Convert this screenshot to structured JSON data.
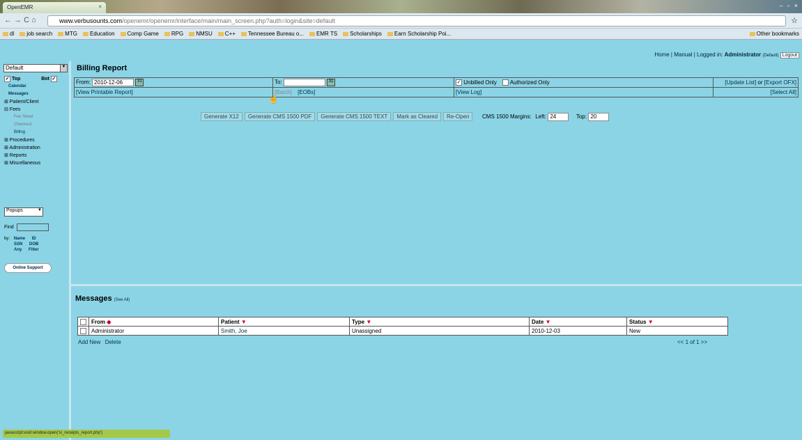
{
  "browser": {
    "tab_title": "OpenEMR",
    "url_domain": "www.verbusounts.com",
    "url_path": "/openemr/openemr/interface/main/main_screen.php?auth=login&site=default",
    "window_controls": "– ▫ ×",
    "bookmarks": [
      "dl",
      "job search",
      "MTG",
      "Education",
      "Comp Game",
      "RPG",
      "NMSU",
      "C++",
      "Tennessee Bureau o...",
      "EMR TS",
      "Scholarships",
      "Earn Scholarship Poi..."
    ],
    "other_bookmarks": "Other bookmarks",
    "status_url": "javascript:void window.open('sl_receipts_report.php')"
  },
  "topnav": {
    "home": "Home",
    "manual": "Manual",
    "logged_in": "Logged in:",
    "user": "Administrator",
    "facility": "(Default)",
    "logout": "Logout",
    "sep": "|"
  },
  "sidebar": {
    "select": "Default",
    "top": "Top",
    "bot": "Bot",
    "items": [
      {
        "label": "Calendar",
        "kind": "l2"
      },
      {
        "label": "Messages",
        "kind": "l2"
      },
      {
        "label": "⊞ Patient/Client",
        "kind": "l1"
      },
      {
        "label": "⊟ Fees",
        "kind": "l1"
      },
      {
        "label": "Fee Sheet",
        "kind": "sub"
      },
      {
        "label": "Checkout",
        "kind": "sub"
      },
      {
        "label": "Billing",
        "kind": "subact"
      },
      {
        "label": "⊞ Procedures",
        "kind": "l1"
      },
      {
        "label": "⊞ Administration",
        "kind": "l1"
      },
      {
        "label": "⊞ Reports",
        "kind": "l1"
      },
      {
        "label": "⊞ Miscellaneous",
        "kind": "l1"
      }
    ],
    "popups": "Popups",
    "find": "Find",
    "by": "by:",
    "name": "Name",
    "id": "ID",
    "ssn": "SSN",
    "dob": "DOB",
    "any": "Any",
    "filter": "Filter",
    "online_support": "Online Support"
  },
  "billing": {
    "title": "Billing Report",
    "from_label": "From:",
    "from_value": "2010-12-06",
    "to_label": "To:",
    "to_value": "",
    "unbilled_only": "Unbilled Only",
    "authorized_only": "Authorized Only",
    "update_list": "[Update List]",
    "or": "or",
    "export_ofx": "[Export OFX]",
    "view_printable": "[View Printable Report]",
    "batch_link": "[Batch]",
    "eobs": "[EOBs]",
    "view_log": "[View Log]",
    "select_all": "[Select All]",
    "buttons": [
      "Generate X12",
      "Generate CMS 1500 PDF",
      "Generate CMS 1500 TEXT",
      "Mark as Cleared",
      "Re-Open"
    ],
    "margins_label": "CMS 1500 Margins:",
    "left_label": "Left:",
    "left_value": "24",
    "top_label": "Top:",
    "top_value": "20"
  },
  "messages": {
    "title": "Messages",
    "see_all": "(See All)",
    "columns": [
      "From",
      "Patient",
      "Type",
      "Date",
      "Status"
    ],
    "rows": [
      {
        "from": "Administrator",
        "patient": "Smith, Joe",
        "type": "Unassigned",
        "date": "2010-12-03",
        "status": "New"
      }
    ],
    "add_new": "Add New",
    "delete": "Delete",
    "pager": "<< 1 of 1 >>"
  }
}
